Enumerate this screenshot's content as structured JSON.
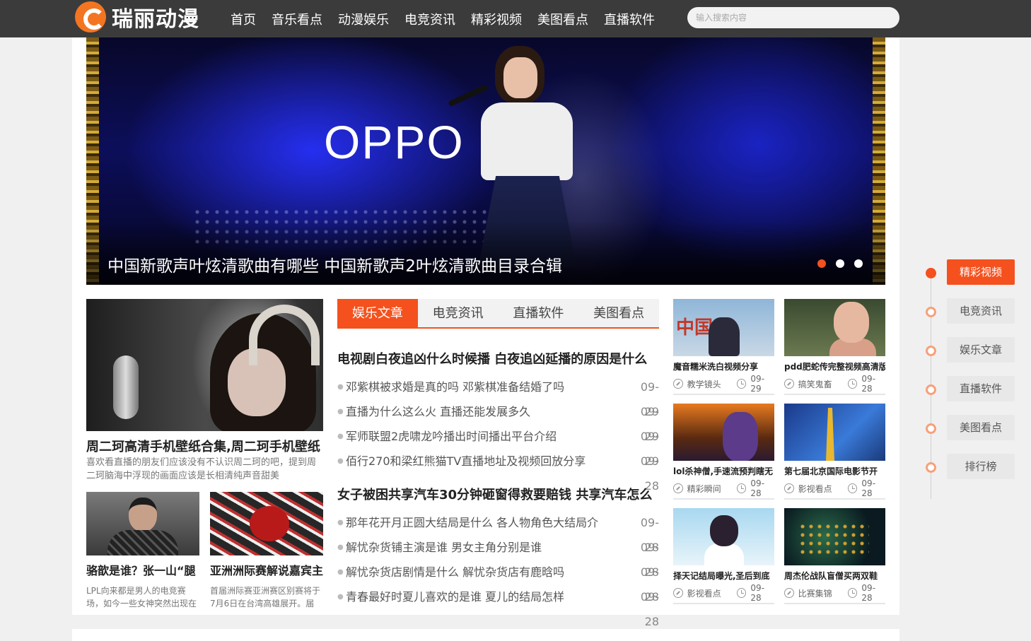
{
  "header": {
    "logo_text": "瑞丽动漫",
    "nav": [
      "首页",
      "音乐看点",
      "动漫娱乐",
      "电竞资讯",
      "精彩视频",
      "美图看点",
      "直播软件"
    ],
    "search_placeholder": "输入搜索内容"
  },
  "banner": {
    "title": "中国新歌声叶炫清歌曲有哪些 中国新歌声2叶炫清歌曲目录合辑",
    "stage_logo": "OPPO",
    "slides_total": 3,
    "active_slide": 1
  },
  "featured": {
    "title": "周二珂高清手机壁纸合集,周二珂手机壁纸",
    "desc": "喜欢看直播的朋友们应该没有不认识周二珂的吧，提到周二珂脑海中浮现的画面应该是长相清纯声音甜美"
  },
  "small_cards": [
    {
      "title": "骆歆是谁？张一山“腿",
      "desc": "LPL向来都是男人的电竞赛场，如今一些女神突然出现在"
    },
    {
      "title": "亚洲洲际赛解说嘉宾主",
      "desc": "首届洲际赛亚洲赛区别赛将于7月6日在台湾高雄展开。届"
    }
  ],
  "tabs": [
    "娱乐文章",
    "电竞资讯",
    "直播软件",
    "美图看点"
  ],
  "article_groups": [
    {
      "headline": "电视剧白夜追凶什么时候播 白夜追凶延播的原因是什么",
      "items": [
        {
          "title": "邓紫棋被求婚是真的吗 邓紫棋准备结婚了吗",
          "date": "09-29"
        },
        {
          "title": "直播为什么这么火 直播还能发展多久",
          "date": "09-29"
        },
        {
          "title": "军师联盟2虎啸龙吟播出时间播出平台介绍",
          "date": "09-29"
        },
        {
          "title": "佰行270和梁红熊猫TV直播地址及视频回放分享",
          "date": "09-28"
        }
      ]
    },
    {
      "headline": "女子被困共享汽车30分钟砸窗得救要赔钱 共享汽车怎么",
      "items": [
        {
          "title": "那年花开月正圆大结局是什么 各人物角色大结局介",
          "date": "09-28"
        },
        {
          "title": "解忧杂货铺主演是谁 男女主角分别是谁",
          "date": "09-28"
        },
        {
          "title": "解忧杂货店剧情是什么 解忧杂货店有鹿晗吗",
          "date": "09-28"
        },
        {
          "title": "青春最好时夏儿喜欢的是谁 夏儿的结局怎样",
          "date": "09-28"
        }
      ]
    }
  ],
  "thumbs": [
    {
      "title": "魔音糯米洗白视频分享",
      "category": "教学镜头",
      "date": "09-29",
      "overlay": "中国魔"
    },
    {
      "title": "pdd肥蛇传完整视频高清版",
      "category": "搞笑鬼畜",
      "date": "09-28"
    },
    {
      "title": "lol杀神僧,手速流预判瞎无",
      "category": "精彩瞬间",
      "date": "09-28"
    },
    {
      "title": "第七届北京国际电影节开",
      "category": "影视看点",
      "date": "09-28"
    },
    {
      "title": "择天记结局曝光,圣后到底",
      "category": "影视看点",
      "date": "09-28"
    },
    {
      "title": "周杰伦战队盲僧买两双鞋",
      "category": "比赛集锦",
      "date": "09-28"
    }
  ],
  "side_nav": [
    "精彩视频",
    "电竞资讯",
    "娱乐文章",
    "直播软件",
    "美图看点",
    "排行榜"
  ],
  "colors": {
    "accent": "#f4511e",
    "header_bg": "#3b3b3b"
  }
}
